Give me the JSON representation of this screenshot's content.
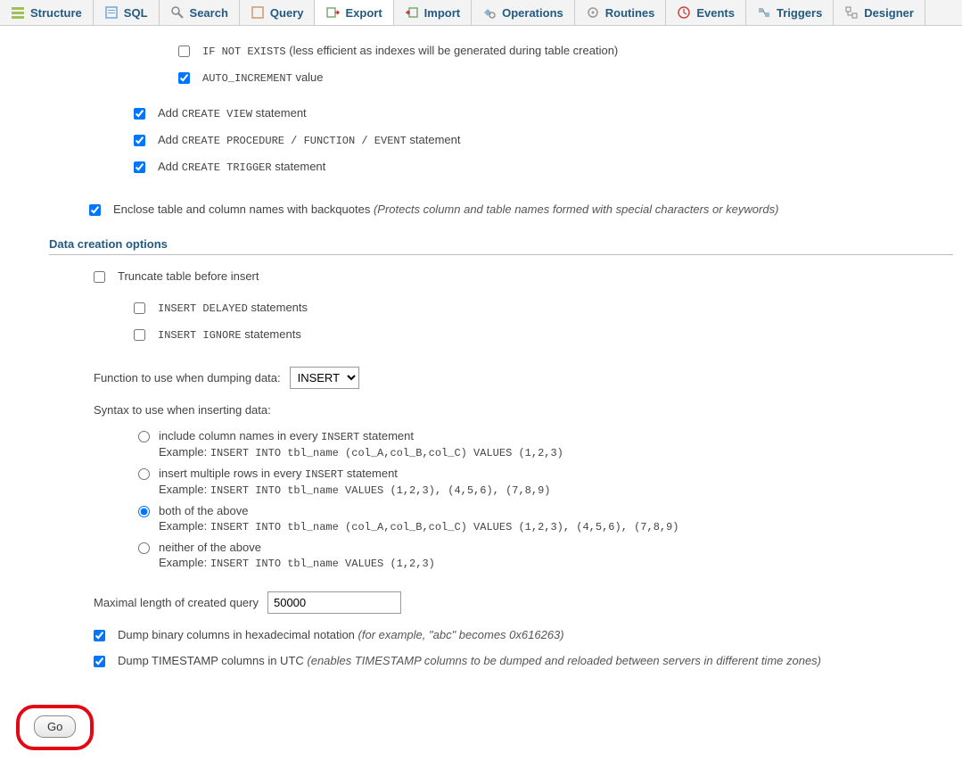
{
  "tabs": [
    {
      "label": "Structure"
    },
    {
      "label": "SQL"
    },
    {
      "label": "Search"
    },
    {
      "label": "Query"
    },
    {
      "label": "Export"
    },
    {
      "label": "Import"
    },
    {
      "label": "Operations"
    },
    {
      "label": "Routines"
    },
    {
      "label": "Events"
    },
    {
      "label": "Triggers"
    },
    {
      "label": "Designer"
    }
  ],
  "opts": {
    "if_not_exists_code": "IF NOT EXISTS",
    "if_not_exists_text": " (less efficient as indexes will be generated during table creation)",
    "auto_increment_code": "AUTO_INCREMENT",
    "auto_increment_text": " value",
    "create_view_prefix": "Add ",
    "create_view_code": "CREATE VIEW",
    "create_view_suffix": " statement",
    "create_proc_prefix": "Add ",
    "create_proc_code": "CREATE PROCEDURE / FUNCTION / EVENT",
    "create_proc_suffix": " statement",
    "create_trigger_prefix": "Add ",
    "create_trigger_code": "CREATE TRIGGER",
    "create_trigger_suffix": " statement",
    "backquotes_text": "Enclose table and column names with backquotes ",
    "backquotes_hint": "(Protects column and table names formed with special characters or keywords)"
  },
  "section_data": "Data creation options",
  "data_opts": {
    "truncate": "Truncate table before insert",
    "insert_delayed_code": "INSERT DELAYED",
    "insert_delayed_text": " statements",
    "insert_ignore_code": "INSERT IGNORE",
    "insert_ignore_text": " statements",
    "func_label": "Function to use when dumping data:",
    "func_value": "INSERT",
    "syntax_label": "Syntax to use when inserting data:",
    "r1_text1": "include column names in every ",
    "r1_code": "INSERT",
    "r1_text2": " statement",
    "r1_ex_label": "Example: ",
    "r1_ex_code": "INSERT INTO tbl_name (col_A,col_B,col_C) VALUES (1,2,3)",
    "r2_text1": "insert multiple rows in every ",
    "r2_code": "INSERT",
    "r2_text2": " statement",
    "r2_ex_label": "Example: ",
    "r2_ex_code": "INSERT INTO tbl_name VALUES (1,2,3), (4,5,6), (7,8,9)",
    "r3_text": "both of the above",
    "r3_ex_label": "Example: ",
    "r3_ex_code": "INSERT INTO tbl_name (col_A,col_B,col_C) VALUES (1,2,3), (4,5,6), (7,8,9)",
    "r4_text": "neither of the above",
    "r4_ex_label": "Example: ",
    "r4_ex_code": "INSERT INTO tbl_name VALUES (1,2,3)",
    "maxlen_label": "Maximal length of created query",
    "maxlen_value": "50000",
    "hexdump_text": "Dump binary columns in hexadecimal notation ",
    "hexdump_hint": "(for example, \"abc\" becomes 0x616263)",
    "utc_text": "Dump TIMESTAMP columns in UTC ",
    "utc_hint": "(enables TIMESTAMP columns to be dumped and reloaded between servers in different time zones)"
  },
  "go_label": "Go"
}
